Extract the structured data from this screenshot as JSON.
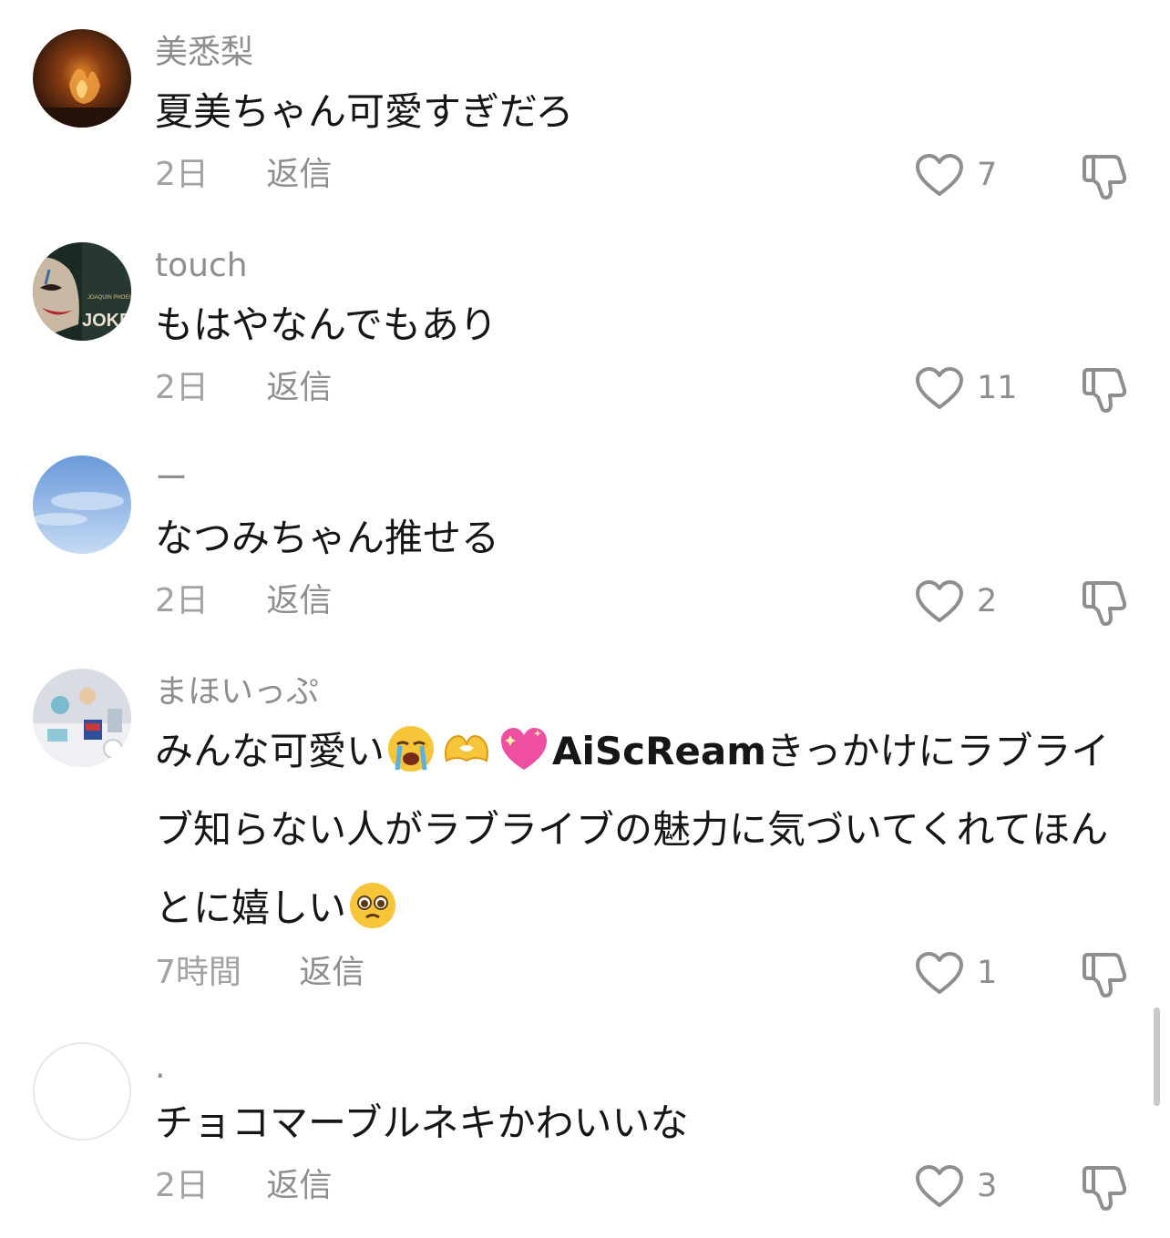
{
  "comments": [
    {
      "username": "美悉梨",
      "text": "夏美ちゃん可愛すぎだろ",
      "time": "2日",
      "reply_label": "返信",
      "likes": "7",
      "avatar_icon": "avatar-fire-photo"
    },
    {
      "username": "touch",
      "text": "もはやなんでもあり",
      "time": "2日",
      "reply_label": "返信",
      "likes": "11",
      "avatar_icon": "avatar-joker-poster",
      "avatar_text": "JOKER"
    },
    {
      "username": "ー",
      "text": "なつみちゃん推せる",
      "time": "2日",
      "reply_label": "返信",
      "likes": "2",
      "avatar_icon": "avatar-sky-photo"
    },
    {
      "username": "まほいっぷ",
      "text_part1": "みんな可愛い",
      "emoji1": "loudly-crying-face-emoji",
      "emoji2": "heart-hands-emoji",
      "emoji3": "sparkling-heart-emoji",
      "brand": "AiScReam",
      "text_part2": "きっかけにラブライブ知らない人がラブライブの魅力に気づいてくれてほんとに嬉しい",
      "emoji4": "pleading-face-emoji",
      "time": "7時間",
      "reply_label": "返信",
      "likes": "1",
      "avatar_icon": "avatar-figures-photo"
    },
    {
      "username": ".",
      "text": "チョコマーブルネキかわいいな",
      "time": "2日",
      "reply_label": "返信",
      "likes": "3",
      "avatar_icon": "avatar-blank"
    }
  ],
  "colors": {
    "username": "#8e8e8e",
    "body": "#161616",
    "meta": "#a2a2a2"
  }
}
